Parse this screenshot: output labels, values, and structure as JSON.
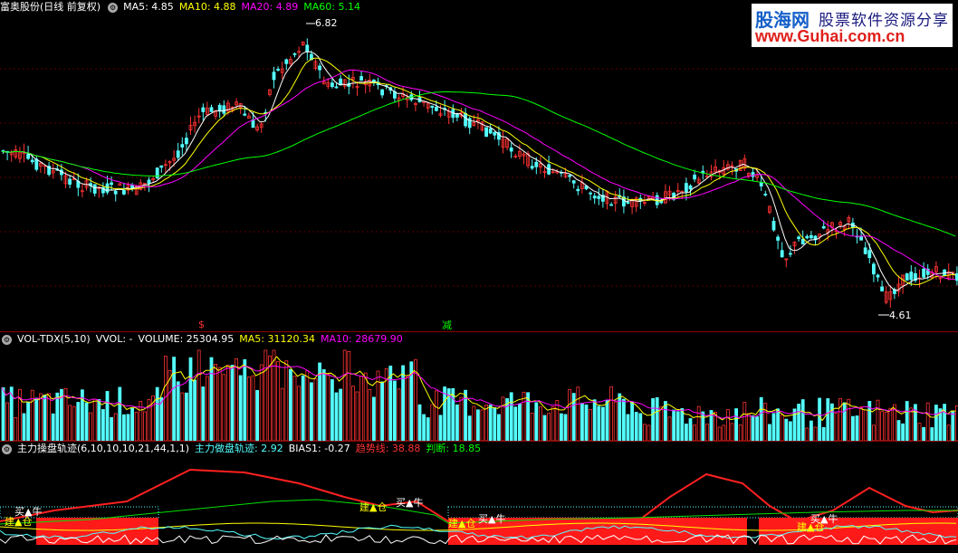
{
  "main_panel": {
    "stock_name": "富奥股份(日线 前复权)",
    "ma5": "MA5: 4.85",
    "ma10": "MA10: 4.88",
    "ma20": "MA20: 4.89",
    "ma60": "MA60: 5.14",
    "high_label": "6.82",
    "low_label": "4.61",
    "signal_buy": "$",
    "signal_reduce": "减"
  },
  "vol_panel": {
    "title": "VOL-TDX(5,10)",
    "vvol": "VVOL: -",
    "volume": "VOLUME: 25304.95",
    "ma5": "MA5: 31120.34",
    "ma10": "MA10: 28679.90"
  },
  "ind_panel": {
    "title": "主力操盘轨迹(6,10,10,10,21,44,1,1)",
    "track": "主力做盘轨迹: 2.92",
    "bias": "BIAS1: -0.27",
    "trend": "趋势线: 38.88",
    "judge": "判断: 18.85",
    "marks": {
      "build": "建▲仓",
      "buy": "买▲牛"
    }
  },
  "watermark": {
    "line1": "股海网",
    "line1b": "股票软件资源分享",
    "line2": "www.Guhai.com.cn"
  },
  "colors": {
    "up": "#ff3232",
    "down": "#54ffff",
    "ma5": "#ffffff",
    "ma10": "#ffff00",
    "ma20": "#ff00ff",
    "ma60": "#00ff00"
  }
}
